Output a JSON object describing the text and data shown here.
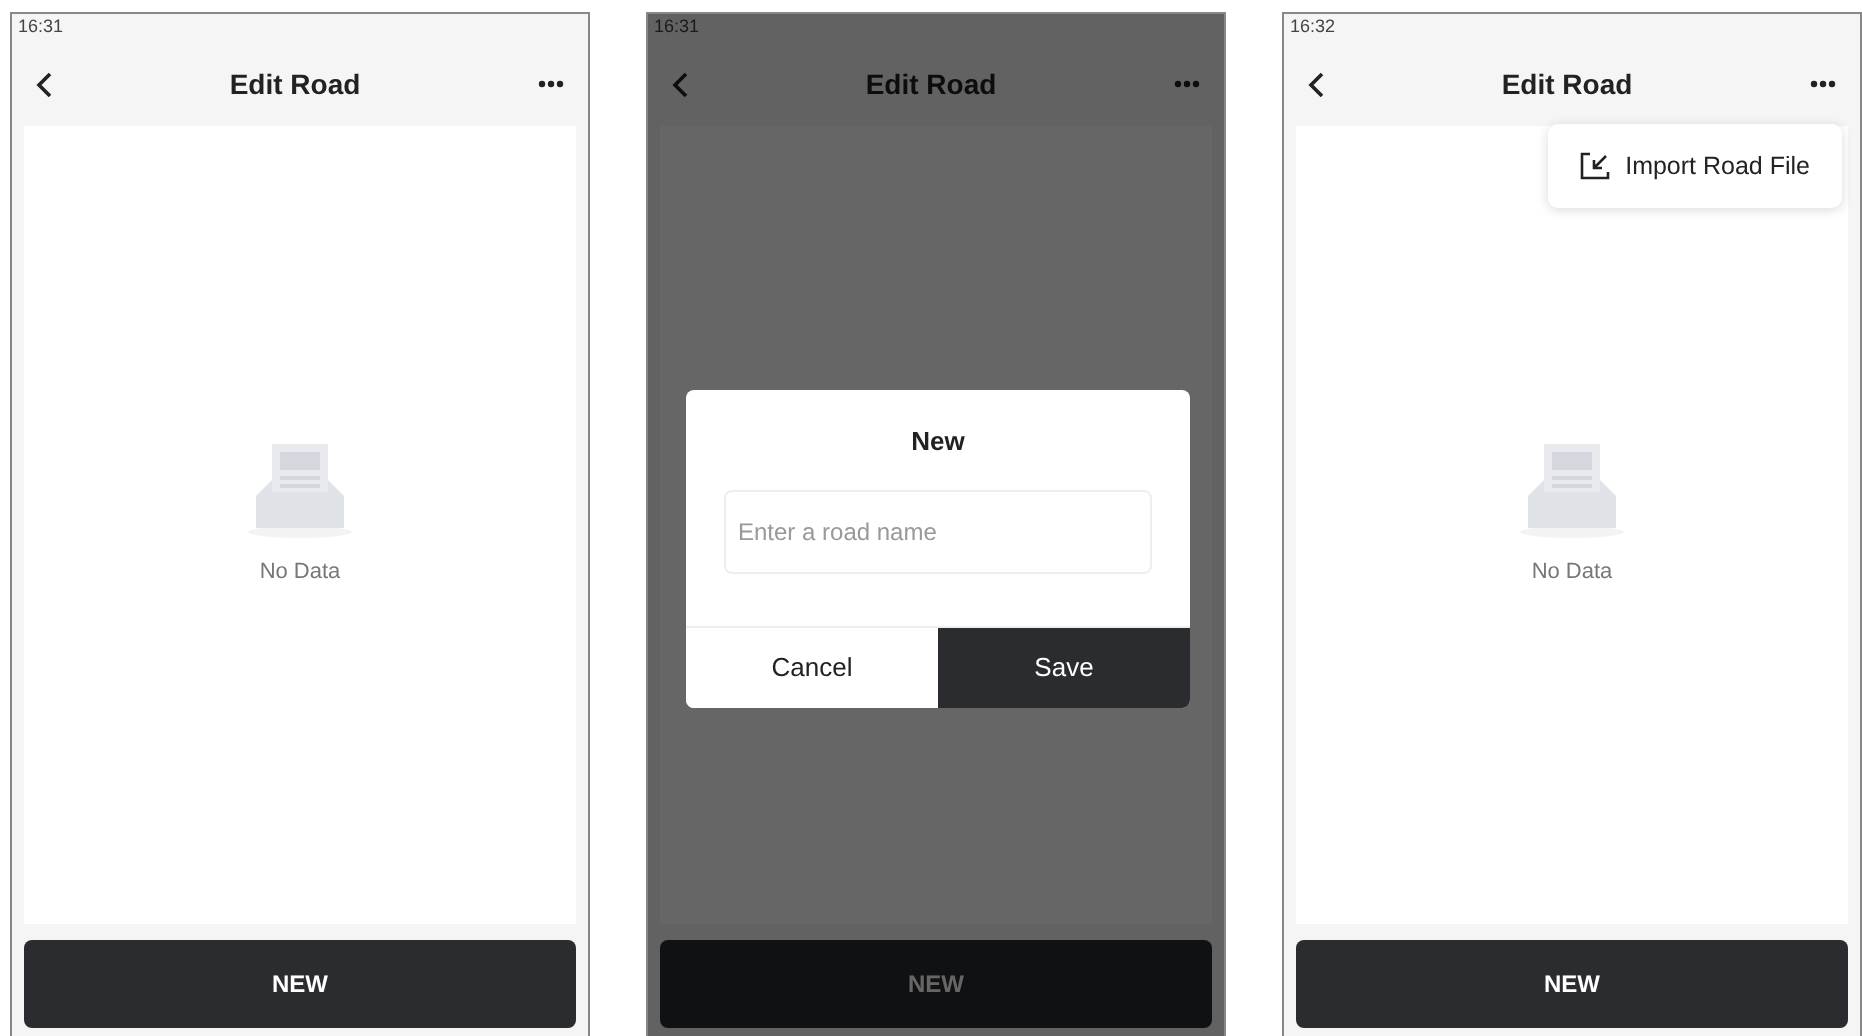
{
  "screens": [
    {
      "time": "16:31",
      "title": "Edit Road",
      "dimmed": false,
      "empty_state": {
        "text": "No Data"
      },
      "button": "NEW"
    },
    {
      "time": "16:31",
      "title": "Edit Road",
      "dimmed": true,
      "dialog": {
        "title": "New",
        "placeholder": "Enter a road name",
        "buttons": [
          {
            "label": "Cancel",
            "kind": "secondary"
          },
          {
            "label": "Save",
            "kind": "primary"
          }
        ]
      },
      "button": "NEW"
    },
    {
      "time": "16:32",
      "title": "Edit Road",
      "dimmed": false,
      "menu": [
        {
          "label": "Import Road File"
        }
      ],
      "empty_state": {
        "text": "No Data"
      },
      "button": "NEW"
    }
  ]
}
